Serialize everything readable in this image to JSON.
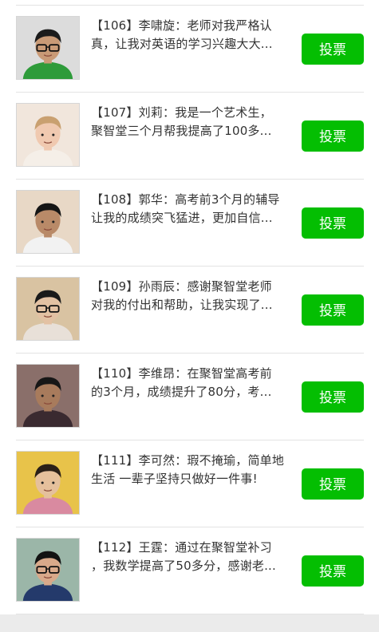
{
  "items": [
    {
      "id_label": "【106】",
      "name": "李啸旋",
      "line1": "：老师对我严格认",
      "line2": "真，让我对英语的学习兴趣大大...",
      "vote_label": "投票",
      "avatar_icon": "student-portrait-icon"
    },
    {
      "id_label": "【107】",
      "name": "刘莉",
      "line1": "：我是一个艺术生，",
      "line2": "聚智堂三个月帮我提高了100多...",
      "vote_label": "投票",
      "avatar_icon": "student-portrait-icon"
    },
    {
      "id_label": "【108】",
      "name": "郭华",
      "line1": "：高考前3个月的辅导",
      "line2": "让我的成绩突飞猛进，更加自信...",
      "vote_label": "投票",
      "avatar_icon": "student-portrait-icon"
    },
    {
      "id_label": "【109】",
      "name": "孙雨辰",
      "line1": "：感谢聚智堂老师",
      "line2": "对我的付出和帮助，让我实现了...",
      "vote_label": "投票",
      "avatar_icon": "student-portrait-icon"
    },
    {
      "id_label": "【110】",
      "name": "李维昂",
      "line1": "：在聚智堂高考前",
      "line2": "的3个月，成绩提升了80分，考...",
      "vote_label": "投票",
      "avatar_icon": "student-portrait-icon"
    },
    {
      "id_label": "【111】",
      "name": "李可然",
      "line1": "：瑕不掩瑜，简单地",
      "line2": "生活 一辈子坚持只做好一件事!",
      "vote_label": "投票",
      "avatar_icon": "student-portrait-icon"
    },
    {
      "id_label": "【112】",
      "name": "王霆",
      "line1": "：通过在聚智堂补习",
      "line2": "，我数学提高了50多分，感谢老...",
      "vote_label": "投票",
      "avatar_icon": "student-portrait-icon"
    }
  ],
  "colors": {
    "vote_button": "#04be02",
    "text": "#333333",
    "divider": "#e3e3e3",
    "footer": "#ebebeb"
  }
}
